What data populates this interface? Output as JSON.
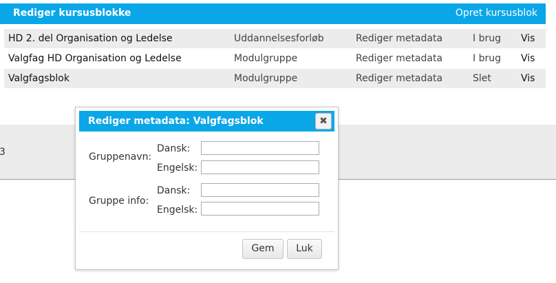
{
  "header": {
    "title": "Rediger kursusblokke",
    "create_link": "Opret kursusblok"
  },
  "rows": [
    {
      "name": "HD 2. del Organisation og Ledelse",
      "type": "Uddannelsesforløb",
      "meta": "Rediger metadata",
      "status": "I brug",
      "view": "Vis"
    },
    {
      "name": "Valgfag HD Organisation og Ledelse",
      "type": "Modulgruppe",
      "meta": "Rediger metadata",
      "status": "I brug",
      "view": "Vis"
    },
    {
      "name": "Valgfagsblok",
      "type": "Modulgruppe",
      "meta": "Rediger metadata",
      "status": "Slet",
      "view": "Vis"
    }
  ],
  "background_edge_text": "3",
  "dialog": {
    "title": "Rediger metadata: Valgfagsblok",
    "close_icon": "close-x",
    "group_name_label": "Gruppenavn:",
    "group_info_label": "Gruppe info:",
    "danish_label": "Dansk:",
    "english_label": "Engelsk:",
    "fields": {
      "name_da": "",
      "name_en": "",
      "info_da": "",
      "info_en": ""
    },
    "save_label": "Gem",
    "close_label": "Luk"
  },
  "colors": {
    "accent": "#0aa7e8",
    "row_shade": "#ececec"
  }
}
